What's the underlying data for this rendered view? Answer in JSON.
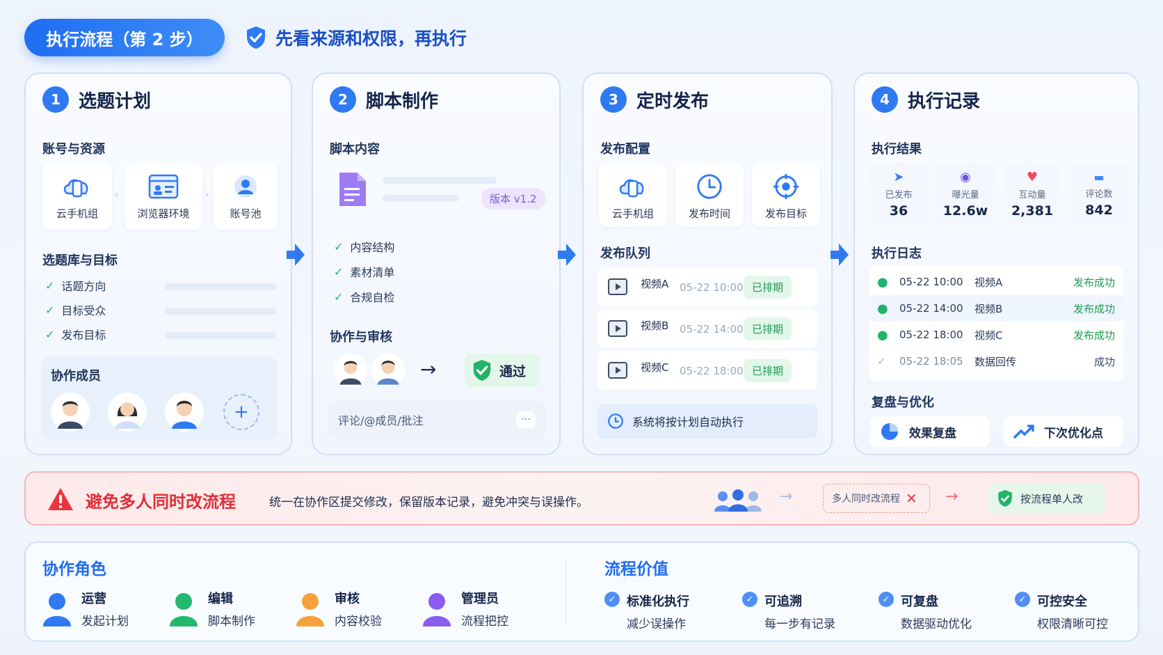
{
  "header": {
    "title": "执行流程（第 2 步）",
    "subtitle": "先看来源和权限，再执行"
  },
  "step1": {
    "num": "1",
    "title": "选题计划",
    "section_accounts": "账号与资源",
    "tiles": [
      {
        "label": "云手机组",
        "icon": "cloud-phone-icon"
      },
      {
        "label": "浏览器环境",
        "icon": "browser-icon"
      },
      {
        "label": "账号池",
        "icon": "account-pool-icon"
      }
    ],
    "section_topics": "选题库与目标",
    "checks": [
      "话题方向",
      "目标受众",
      "发布目标"
    ],
    "section_members": "协作成员"
  },
  "step2": {
    "num": "2",
    "title": "脚本制作",
    "section_content": "脚本内容",
    "version": "版本 v1.2",
    "checks": [
      "内容结构",
      "素材清单",
      "合规自检"
    ],
    "section_review": "协作与审核",
    "approved": "通过",
    "comment_placeholder": "评论/@成员/批注"
  },
  "step3": {
    "num": "3",
    "title": "定时发布",
    "section_config": "发布配置",
    "tiles": [
      {
        "label": "云手机组",
        "icon": "cloud-phone-icon"
      },
      {
        "label": "发布时间",
        "icon": "clock-icon"
      },
      {
        "label": "发布目标",
        "icon": "target-icon"
      }
    ],
    "section_queue": "发布队列",
    "queue": [
      {
        "name": "视频A",
        "time": "05-22 10:00",
        "status": "已排期"
      },
      {
        "name": "视频B",
        "time": "05-22 14:00",
        "status": "已排期"
      },
      {
        "name": "视频C",
        "time": "05-22 18:00",
        "status": "已排期"
      }
    ],
    "auto_note": "系统将按计划自动执行"
  },
  "step4": {
    "num": "4",
    "title": "执行记录",
    "section_result": "执行结果",
    "stats": [
      {
        "label": "已发布",
        "value": "36",
        "icon": "send-icon",
        "color": "#3b7cf2"
      },
      {
        "label": "曝光量",
        "value": "12.6w",
        "icon": "eye-icon",
        "color": "#6c55e0"
      },
      {
        "label": "互动量",
        "value": "2,381",
        "icon": "heart-icon",
        "color": "#ef4b5c"
      },
      {
        "label": "评论数",
        "value": "842",
        "icon": "comment-icon",
        "color": "#3b8ef2"
      }
    ],
    "section_log": "执行日志",
    "logs": [
      {
        "time": "05-22 10:00",
        "name": "视频A",
        "status": "发布成功"
      },
      {
        "time": "05-22 14:00",
        "name": "视频B",
        "status": "发布成功"
      },
      {
        "time": "05-22 18:00",
        "name": "视频C",
        "status": "发布成功"
      },
      {
        "time": "05-22 18:05",
        "name": "数据回传",
        "status": "成功"
      }
    ],
    "section_review": "复盘与优化",
    "btn_review": "效果复盘",
    "btn_optimize": "下次优化点"
  },
  "warning": {
    "title": "避免多人同时改流程",
    "desc": "统一在协作区提交修改，保留版本记录，避免冲突与误操作。",
    "bad": "多人同时改流程",
    "good": "按流程单人改"
  },
  "roles": {
    "title": "协作角色",
    "items": [
      {
        "name": "运营",
        "desc": "发起计划",
        "color": "#2f7af3"
      },
      {
        "name": "编辑",
        "desc": "脚本制作",
        "color": "#22b86e"
      },
      {
        "name": "审核",
        "desc": "内容校验",
        "color": "#f5a23a"
      },
      {
        "name": "管理员",
        "desc": "流程把控",
        "color": "#8a5cf0"
      }
    ]
  },
  "values": {
    "title": "流程价值",
    "items": [
      {
        "name": "标准化执行",
        "desc": "减少误操作"
      },
      {
        "name": "可追溯",
        "desc": "每一步有记录"
      },
      {
        "name": "可复盘",
        "desc": "数据驱动优化"
      },
      {
        "name": "可控安全",
        "desc": "权限清晰可控"
      }
    ]
  },
  "colors": {
    "primary": "#2f7af3",
    "success": "#22b36b",
    "danger": "#e8363f"
  }
}
